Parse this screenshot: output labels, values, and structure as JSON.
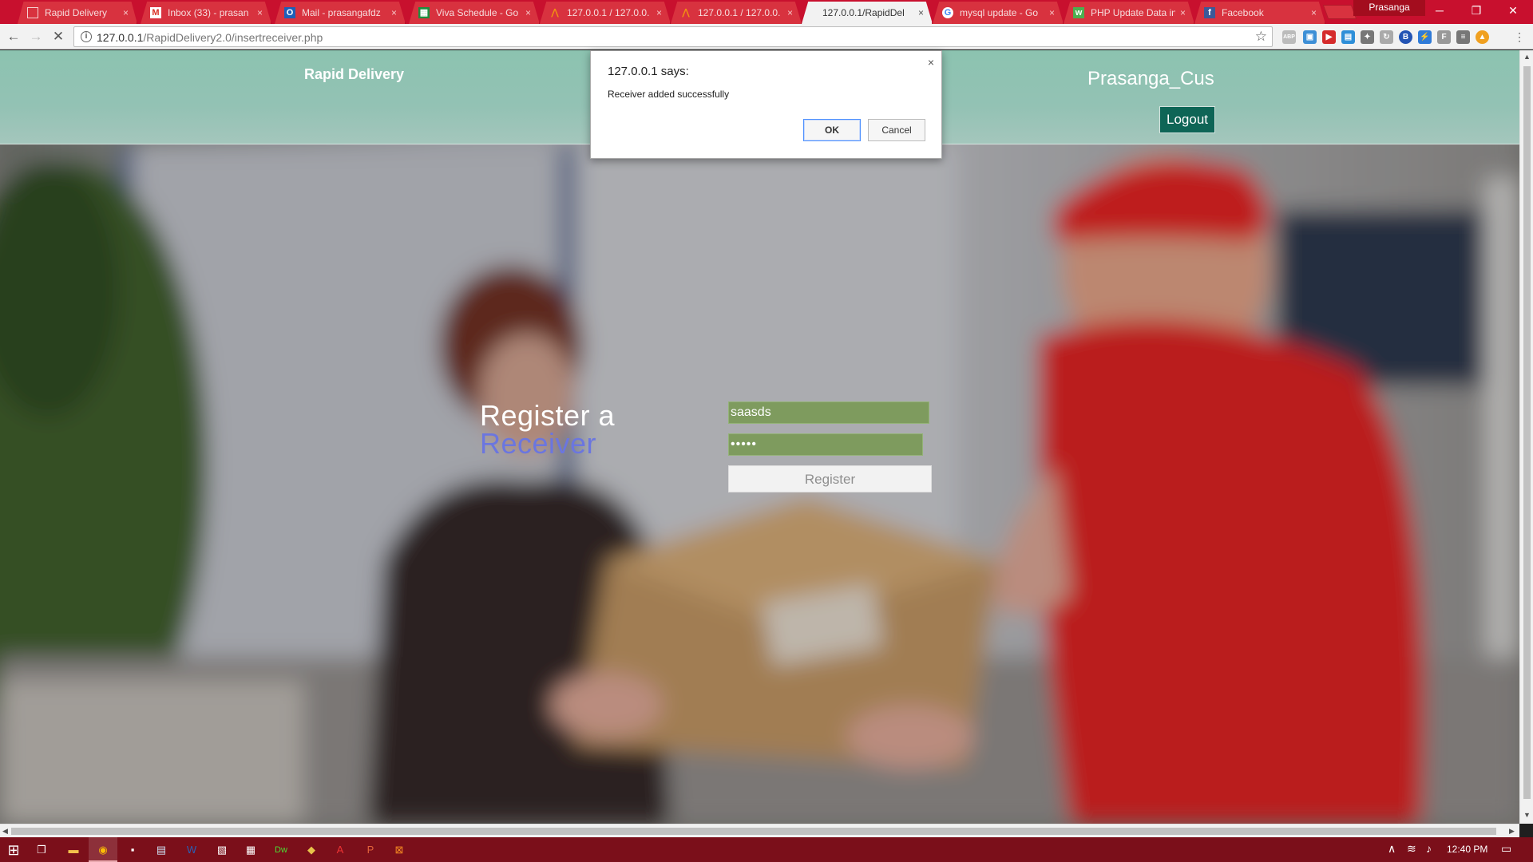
{
  "browser": {
    "tabs": [
      {
        "label": "Rapid Delivery",
        "favicon": "page-icon",
        "active": false
      },
      {
        "label": "Inbox (33) - prasan",
        "favicon": "gmail-icon",
        "active": false
      },
      {
        "label": "Mail - prasangafdz",
        "favicon": "outlook-icon",
        "active": false
      },
      {
        "label": "Viva Schedule - Go",
        "favicon": "sheets-icon",
        "active": false
      },
      {
        "label": "127.0.0.1 / 127.0.0.",
        "favicon": "phpmyadmin-icon",
        "active": false
      },
      {
        "label": "127.0.0.1 / 127.0.0.",
        "favicon": "phpmyadmin-icon",
        "active": false
      },
      {
        "label": "127.0.0.1/RapidDel",
        "favicon": "none",
        "active": true
      },
      {
        "label": "mysql update - Go",
        "favicon": "google-icon",
        "active": false
      },
      {
        "label": "PHP Update Data in",
        "favicon": "w3schools-icon",
        "active": false
      },
      {
        "label": "Facebook",
        "favicon": "facebook-icon",
        "active": false
      }
    ],
    "tab_close": "×",
    "profile_name": "Prasanga",
    "window_controls": {
      "minimize": "─",
      "maximize": "❐",
      "close": "✕"
    },
    "url_host": "127.0.0.1",
    "url_path": "/RapidDelivery2.0/insertreceiver.php",
    "extensions": [
      "ABP",
      "B",
      "F"
    ]
  },
  "page": {
    "brand": "Rapid Delivery",
    "username": "Prasanga_Cus",
    "logout_label": "Logout",
    "form_title_line1": "Register a",
    "form_title_line2": "Receiver",
    "name_value": "saasds",
    "password_value": "•••••",
    "register_label": "Register"
  },
  "dialog": {
    "title": "127.0.0.1 says:",
    "message": "Receiver added successfully",
    "ok_label": "OK",
    "cancel_label": "Cancel",
    "close_glyph": "×"
  },
  "taskbar": {
    "time": "12:40 PM"
  },
  "colors": {
    "tabstrip": "#c8102e",
    "header": "#8cc3b0",
    "logout_bg": "#0e6556",
    "field_bg": "#7e9b5e",
    "accent_purple": "#6b76df",
    "taskbar": "#7b0f1a"
  }
}
